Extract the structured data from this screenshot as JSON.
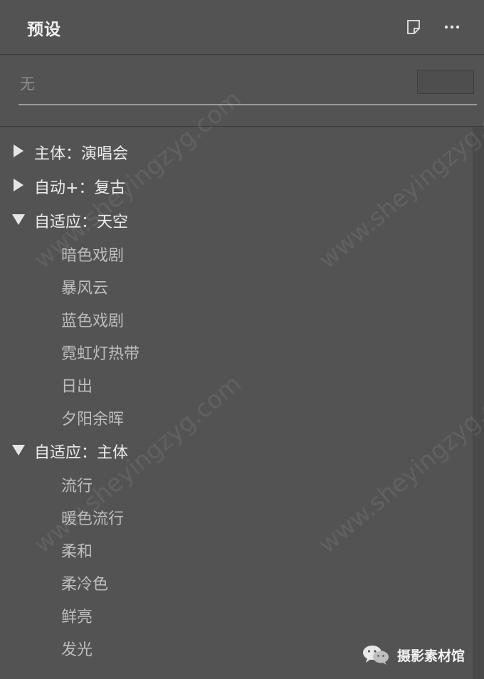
{
  "panel": {
    "title": "预设",
    "new_icon": "new-preset-icon",
    "more_icon": "more-options-icon"
  },
  "search": {
    "value": "无"
  },
  "groups": [
    {
      "label": "主体：演唱会",
      "expanded": false,
      "items": []
    },
    {
      "label": "自动+：复古",
      "expanded": false,
      "items": []
    },
    {
      "label": "自适应：天空",
      "expanded": true,
      "items": [
        "暗色戏剧",
        "暴风云",
        "蓝色戏剧",
        "霓虹灯热带",
        "日出",
        "夕阳余晖"
      ]
    },
    {
      "label": "自适应：主体",
      "expanded": true,
      "items": [
        "流行",
        "暖色流行",
        "柔和",
        "柔冷色",
        "鲜亮",
        "发光"
      ]
    }
  ],
  "watermark": "www.sheyingzyg.com",
  "brand": {
    "icon": "wechat-icon",
    "text": "摄影素材馆"
  },
  "colors": {
    "background": "#535353",
    "text": "#ececec",
    "subitem_text": "#bdbdbd"
  }
}
